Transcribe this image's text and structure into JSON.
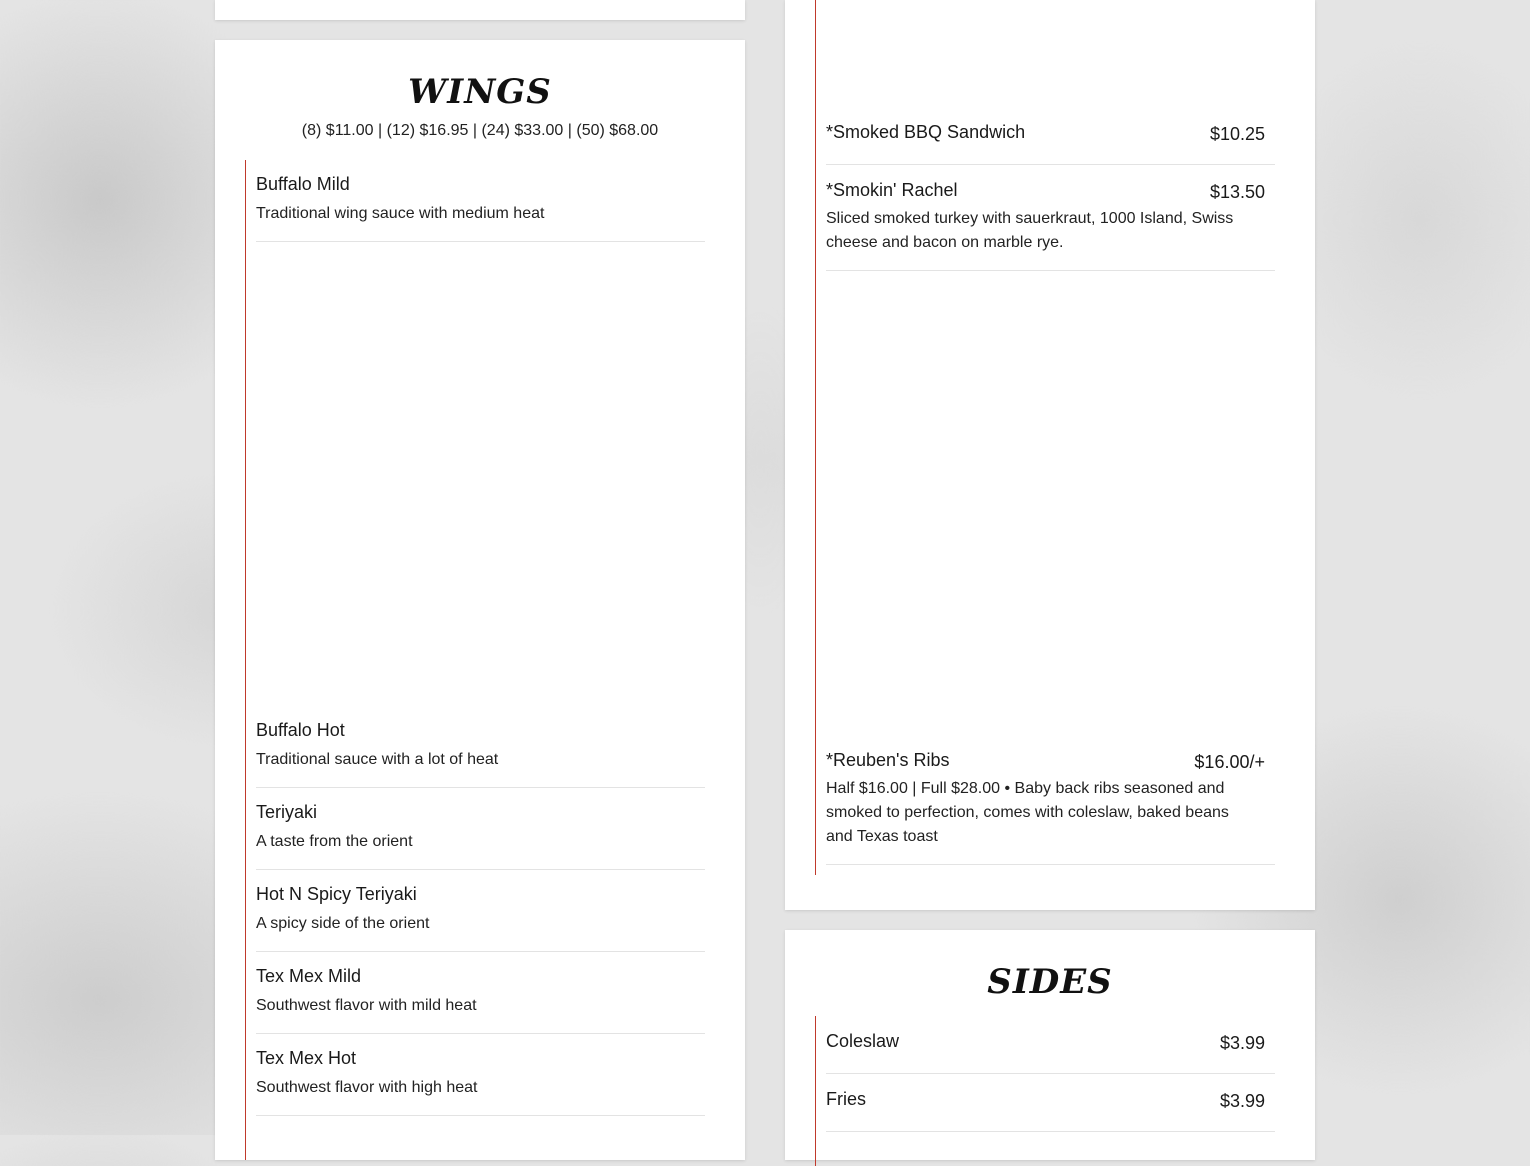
{
  "wings": {
    "title": "WINGS",
    "prices": "(8) $11.00 | (12) $16.95 | (24) $33.00 | (50) $68.00",
    "items": [
      {
        "name": "Buffalo Mild",
        "desc": "Traditional wing sauce with medium heat"
      },
      {
        "name": "Buffalo Hot",
        "desc": "Traditional sauce with a lot of heat"
      },
      {
        "name": "Teriyaki",
        "desc": "A taste from the orient"
      },
      {
        "name": "Hot N Spicy Teriyaki",
        "desc": "A spicy side of the orient"
      },
      {
        "name": "Tex Mex Mild",
        "desc": "Southwest flavor with mild heat"
      },
      {
        "name": "Tex Mex Hot",
        "desc": "Southwest flavor with high heat"
      }
    ]
  },
  "entrees": {
    "items": [
      {
        "name": "*Smoked BBQ Sandwich",
        "price": "$10.25",
        "desc": ""
      },
      {
        "name": "*Smokin' Rachel",
        "price": "$13.50",
        "desc": "Sliced smoked turkey with sauerkraut, 1000 Island, Swiss cheese and bacon on marble rye."
      },
      {
        "name": "*Reuben's Ribs",
        "price": "$16.00/+",
        "desc": "Half $16.00 | Full $28.00 • Baby back ribs seasoned and smoked to perfection, comes with coleslaw, baked beans and Texas toast"
      }
    ]
  },
  "sides": {
    "title": "SIDES",
    "items": [
      {
        "name": "Coleslaw",
        "price": "$3.99"
      },
      {
        "name": "Fries",
        "price": "$3.99"
      }
    ]
  },
  "colors": {
    "accent_line": "#c0392b",
    "panel_bg": "#ffffff"
  }
}
